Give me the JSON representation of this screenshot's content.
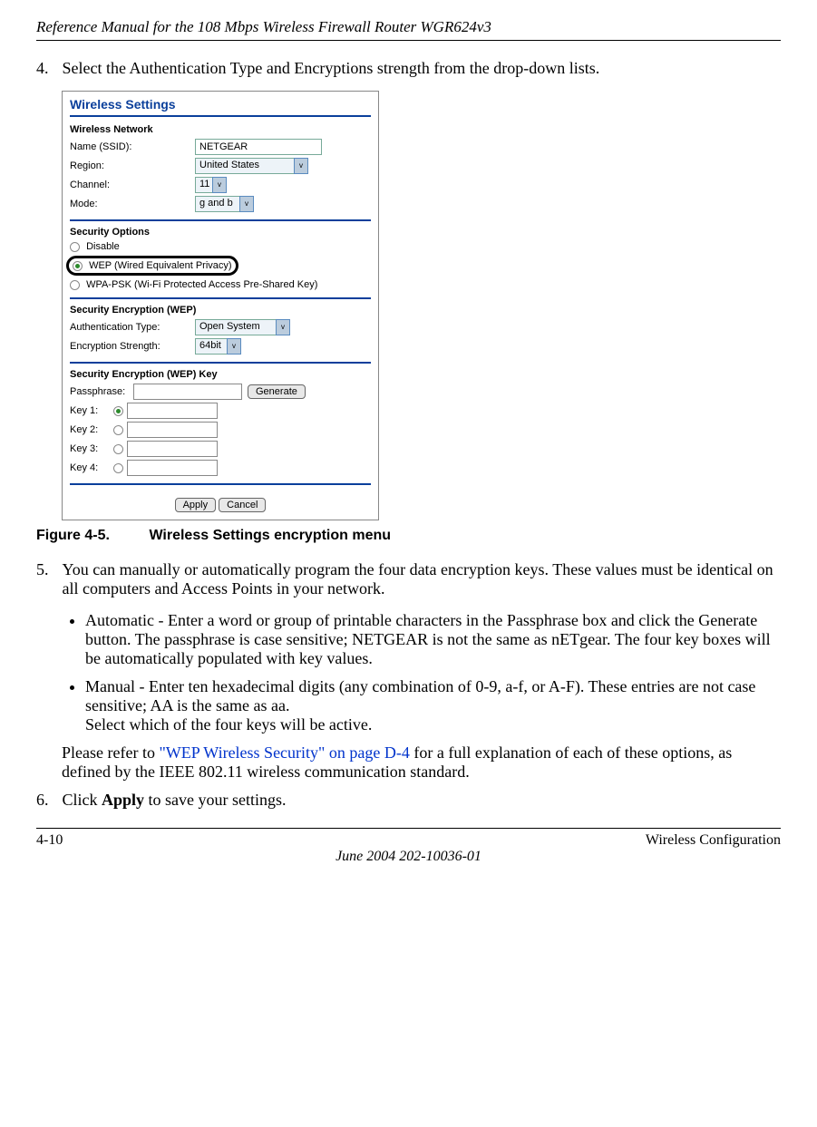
{
  "header": {
    "title": "Reference Manual for the 108 Mbps Wireless Firewall Router WGR624v3"
  },
  "step4": {
    "num": "4.",
    "text": "Select the Authentication Type and Encryptions strength from the drop-down lists."
  },
  "figure": {
    "num": "Figure 4-5.",
    "cap": "Wireless Settings encryption menu"
  },
  "step5": {
    "num": "5.",
    "text": "You can manually or automatically program the four data encryption keys. These values must be identical on all computers and Access Points in your network.",
    "bullet1": "Automatic - Enter a word or group of printable characters in the Passphrase box and click the Generate button. The passphrase is case sensitive; NETGEAR is not the same as nETgear. The four key boxes will be automatically populated with key values.",
    "bullet2": "Manual - Enter ten hexadecimal digits (any combination of 0-9, a-f, or A-F). These entries are not case sensitive; AA is the same as aa.",
    "bullet2b": "Select which of the four keys will be active.",
    "ref_pre": "Please refer to ",
    "ref_link": "\"WEP Wireless Security\" on page D-4",
    "ref_post": " for a full explanation of each of these options, as defined by the IEEE 802.11 wireless communication standard."
  },
  "step6": {
    "num": "6.",
    "pre": "Click ",
    "bold": "Apply",
    "post": " to save your settings."
  },
  "footer": {
    "page": "4-10",
    "section": "Wireless Configuration",
    "date": "June 2004 202-10036-01"
  },
  "ui": {
    "title": "Wireless Settings",
    "wireless_network": "Wireless Network",
    "name_label": "Name (SSID):",
    "name_value": "NETGEAR",
    "region_label": "Region:",
    "region_value": "United States",
    "channel_label": "Channel:",
    "channel_value": "11",
    "mode_label": "Mode:",
    "mode_value": "g and b",
    "sec_options": "Security Options",
    "opt_disable": "Disable",
    "opt_wep": "WEP (Wired Equivalent Privacy)",
    "opt_wpa": "WPA-PSK (Wi-Fi Protected Access Pre-Shared Key)",
    "sec_enc": "Security Encryption (WEP)",
    "auth_label": "Authentication Type:",
    "auth_value": "Open System",
    "enc_label": "Encryption Strength:",
    "enc_value": "64bit",
    "sec_enc_key": "Security Encryption (WEP) Key",
    "pass_label": "Passphrase:",
    "generate": "Generate",
    "key1": "Key 1:",
    "key2": "Key 2:",
    "key3": "Key 3:",
    "key4": "Key 4:",
    "apply": "Apply",
    "cancel": "Cancel"
  }
}
